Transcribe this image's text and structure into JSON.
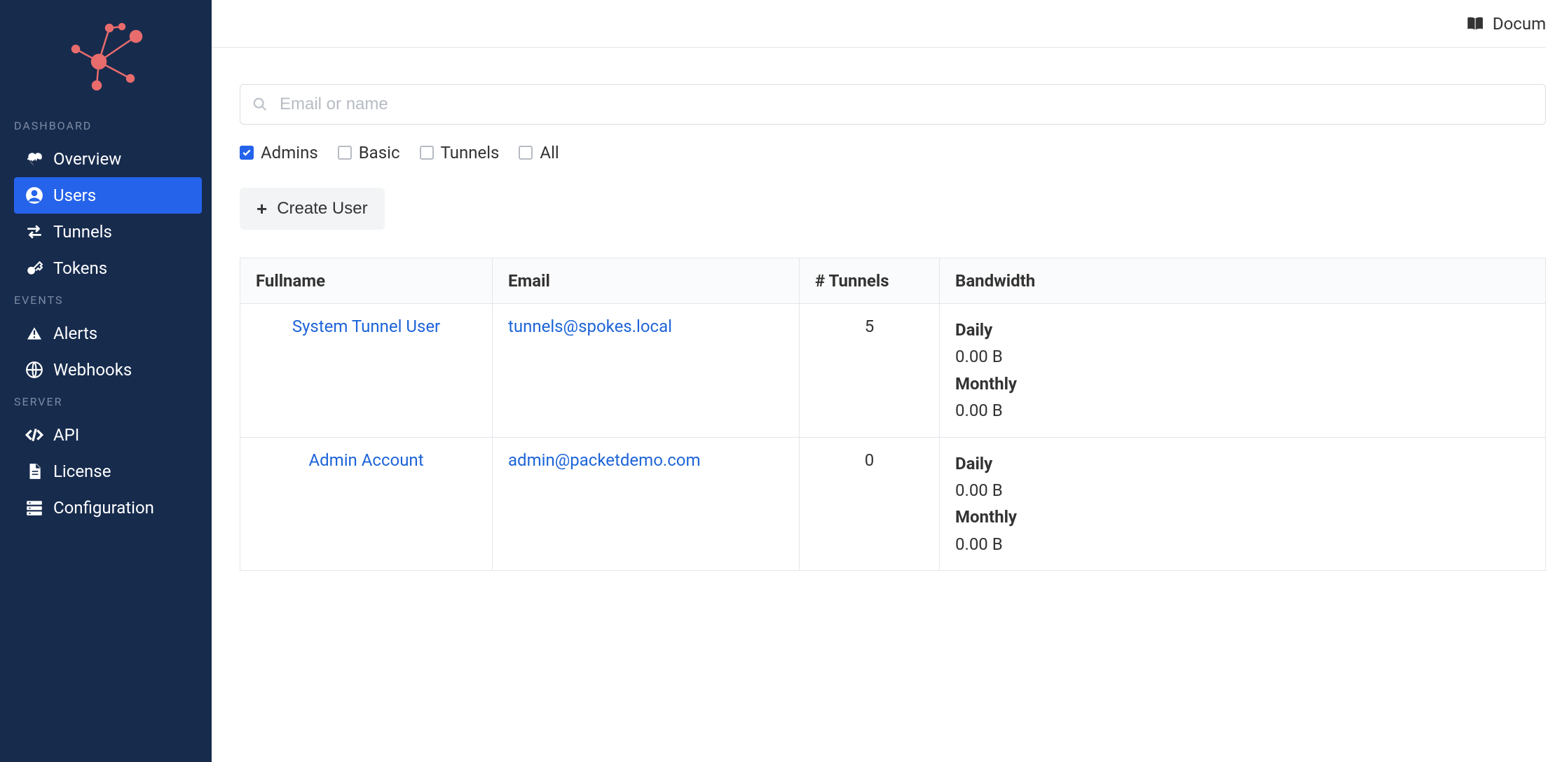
{
  "topbar": {
    "doc_link": "Docum"
  },
  "sidebar": {
    "sections": [
      {
        "title": "DASHBOARD",
        "items": [
          {
            "id": "overview",
            "label": "Overview",
            "icon": "heartbeat-icon",
            "active": false
          },
          {
            "id": "users",
            "label": "Users",
            "icon": "user-circle-icon",
            "active": true
          },
          {
            "id": "tunnels",
            "label": "Tunnels",
            "icon": "exchange-icon",
            "active": false
          },
          {
            "id": "tokens",
            "label": "Tokens",
            "icon": "key-icon",
            "active": false
          }
        ]
      },
      {
        "title": "EVENTS",
        "items": [
          {
            "id": "alerts",
            "label": "Alerts",
            "icon": "warning-icon",
            "active": false
          },
          {
            "id": "webhooks",
            "label": "Webhooks",
            "icon": "globe-icon",
            "active": false
          }
        ]
      },
      {
        "title": "SERVER",
        "items": [
          {
            "id": "api",
            "label": "API",
            "icon": "code-icon",
            "active": false
          },
          {
            "id": "license",
            "label": "License",
            "icon": "file-icon",
            "active": false
          },
          {
            "id": "configuration",
            "label": "Configuration",
            "icon": "server-icon",
            "active": false
          }
        ]
      }
    ]
  },
  "search": {
    "placeholder": "Email or name",
    "value": ""
  },
  "filters": [
    {
      "id": "admins",
      "label": "Admins",
      "checked": true
    },
    {
      "id": "basic",
      "label": "Basic",
      "checked": false
    },
    {
      "id": "tunnels",
      "label": "Tunnels",
      "checked": false
    },
    {
      "id": "all",
      "label": "All",
      "checked": false
    }
  ],
  "create_button": "Create User",
  "table": {
    "headers": [
      "Fullname",
      "Email",
      "# Tunnels",
      "Bandwidth"
    ],
    "bandwidth_labels": {
      "daily": "Daily",
      "monthly": "Monthly"
    },
    "rows": [
      {
        "fullname": "System Tunnel User",
        "email": "tunnels@spokes.local",
        "tunnels": "5",
        "daily": "0.00 B",
        "monthly": "0.00 B"
      },
      {
        "fullname": "Admin Account",
        "email": "admin@packetdemo.com",
        "tunnels": "0",
        "daily": "0.00 B",
        "monthly": "0.00 B"
      }
    ]
  }
}
